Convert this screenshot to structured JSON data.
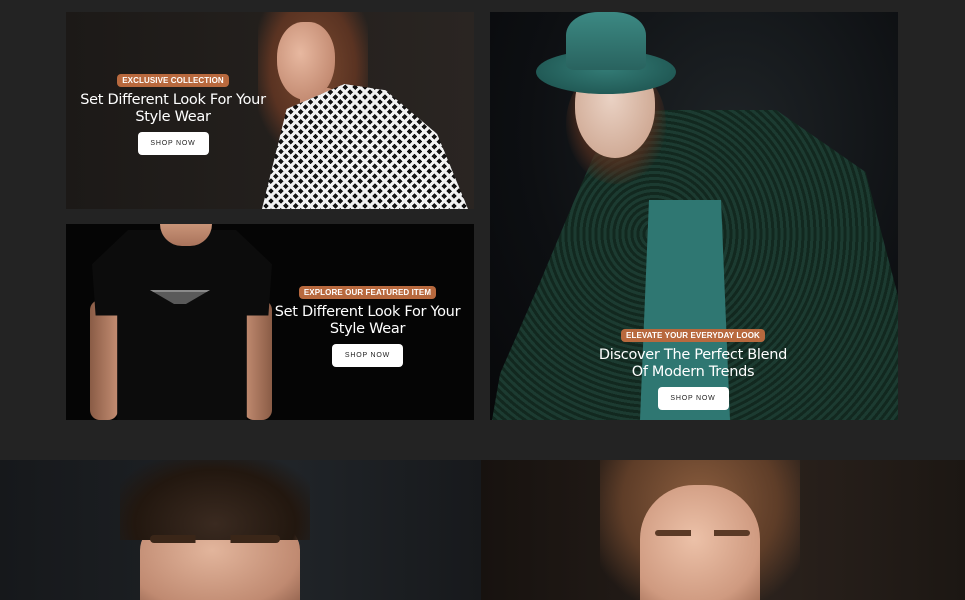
{
  "banners": [
    {
      "tag": "EXCLUSIVE COLLECTION",
      "headline_line1": "Set Different Look For Your",
      "headline_line2": "Style Wear",
      "button": "SHOP NOW"
    },
    {
      "tag": "EXPLORE OUR FEATURED ITEM",
      "headline_line1": "Set Different Look For Your",
      "headline_line2": "Style Wear",
      "button": "SHOP NOW"
    },
    {
      "tag": "ELEVATE YOUR EVERYDAY LOOK",
      "headline_line1": "Discover The Perfect Blend",
      "headline_line2": "Of Modern Trends",
      "button": "SHOP NOW"
    }
  ],
  "colors": {
    "background": "#232323",
    "tag_accent": "#b8693e",
    "button_bg": "#ffffff"
  }
}
